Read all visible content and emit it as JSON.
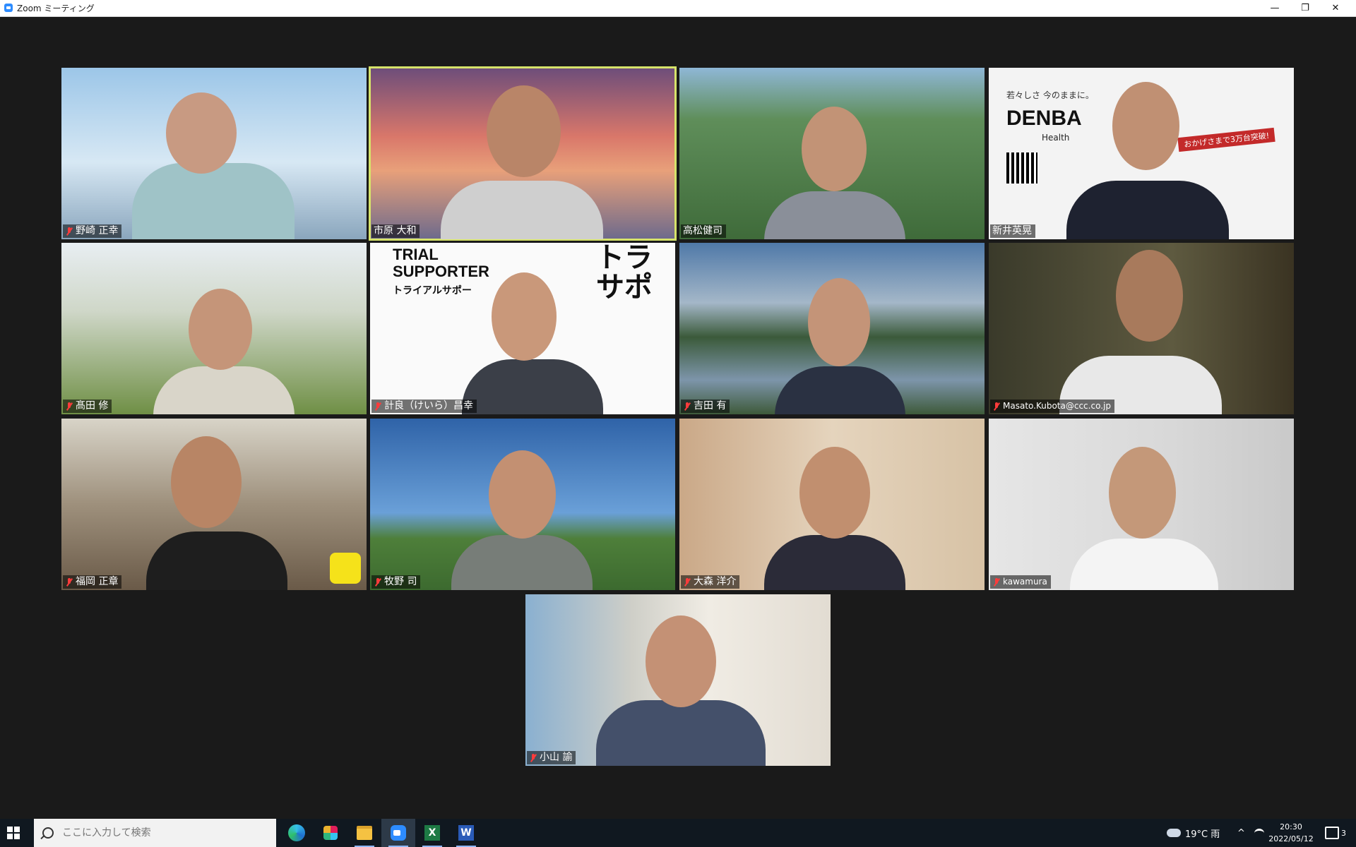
{
  "window": {
    "title": "Zoom ミーティング",
    "minimize": "—",
    "restore": "❐",
    "close": "✕"
  },
  "participants": [
    {
      "name": "野崎 正幸",
      "muted": true
    },
    {
      "name": "市原 大和",
      "muted": false,
      "active_speaker": true
    },
    {
      "name": "高松健司",
      "muted": false
    },
    {
      "name": "新井英晃",
      "muted": false
    },
    {
      "name": "髙田 修",
      "muted": true
    },
    {
      "name": "計良（けいら）昌幸",
      "muted": true
    },
    {
      "name": "吉田 有",
      "muted": true
    },
    {
      "name": "Masato.Kubota@ccc.co.jp",
      "muted": true
    },
    {
      "name": "福岡 正章",
      "muted": true
    },
    {
      "name": "牧野 司",
      "muted": true
    },
    {
      "name": "大森 洋介",
      "muted": true
    },
    {
      "name": "kawamura",
      "muted": true
    },
    {
      "name": "小山 諭",
      "muted": true
    }
  ],
  "backgrounds": {
    "virtual_bg_texts": {
      "denba_tagline": "若々しさ 今のままに。",
      "denba_brand": "DENBA",
      "denba_sub": "Health",
      "denba_ribbon": "おかげさまで3万台突破!",
      "trial_title_1": "TRIAL",
      "trial_title_2": "SUPPORTER",
      "trial_kana": "トライアルサポー",
      "trial_big_1": "トラ",
      "trial_big_2": "サポ"
    }
  },
  "taskbar": {
    "search_placeholder": "ここに入力して検索",
    "apps": [
      "edge-icon",
      "slack-icon",
      "file-explorer-icon",
      "zoom-icon",
      "excel-icon",
      "word-icon"
    ],
    "weather": "19°C 雨",
    "time": "20:30",
    "date": "2022/05/12",
    "notifications": "3"
  }
}
